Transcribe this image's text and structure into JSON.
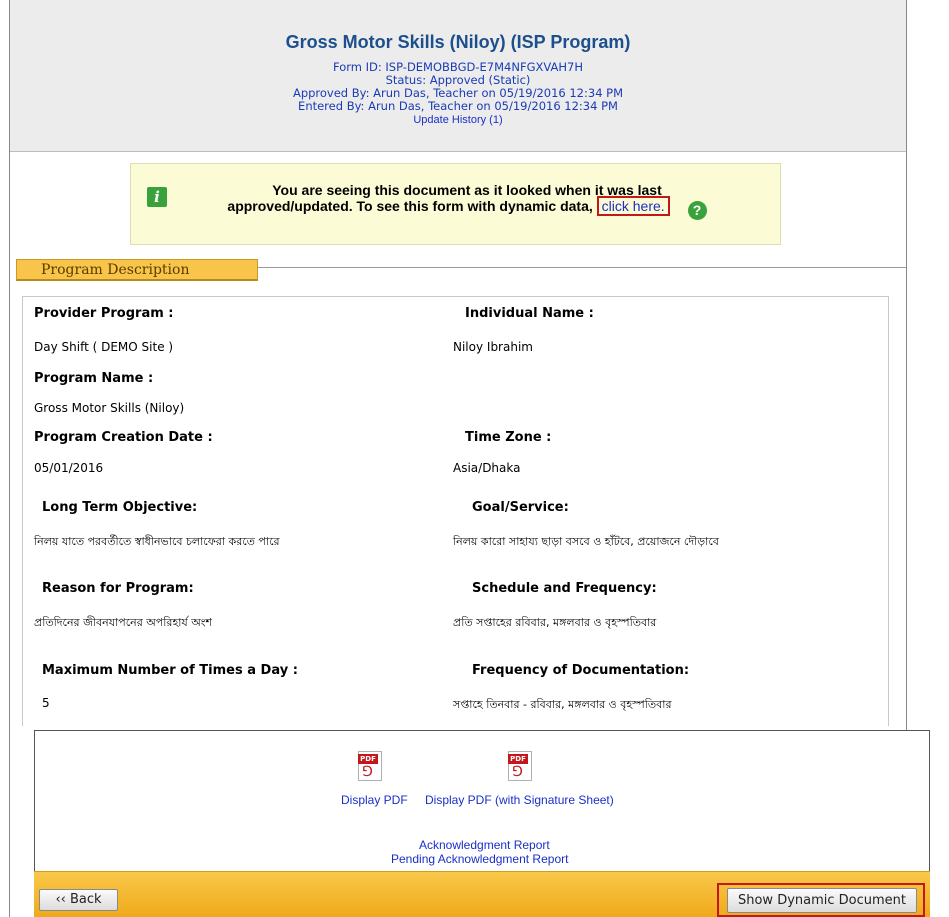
{
  "header": {
    "title": "Gross Motor Skills (Niloy) (ISP Program)",
    "form_id": "Form ID: ISP-DEMOBBGD-E7M4NFGXVAH7H",
    "status": "Status: Approved (Static)",
    "approved_by": "Approved By: Arun Das, Teacher on 05/19/2016 12:34 PM",
    "entered_by": "Entered By: Arun Das, Teacher on 05/19/2016 12:34 PM",
    "update_history": "Update History (1)"
  },
  "notice": {
    "text_line1": "You are seeing this document as it looked when it was last",
    "text_line2": "approved/updated. To see this form with dynamic data,",
    "link": "click here.",
    "info_icon": "i",
    "help_icon": "?"
  },
  "section": {
    "title": "Program Description"
  },
  "details": {
    "provider_program_label": "Provider Program :",
    "provider_program_value": "Day Shift ( DEMO Site )",
    "individual_name_label": "Individual Name :",
    "individual_name_value": "Niloy Ibrahim",
    "program_name_label": "Program Name :",
    "program_name_value": "Gross Motor Skills (Niloy)",
    "creation_date_label": "Program Creation Date :",
    "creation_date_value": "05/01/2016",
    "time_zone_label": "Time Zone :",
    "time_zone_value": "Asia/Dhaka",
    "long_term_label": "Long Term Objective:",
    "long_term_value": "নিলয় যাতে পরবর্তীতে স্বাধীনভাবে চলাফেরা করতে পারে",
    "goal_label": "Goal/Service:",
    "goal_value": "নিলয় কারো সাহায্য ছাড়া বসবে ও হাঁটবে, প্রয়োজনে দৌড়াবে",
    "reason_label": "Reason for Program:",
    "reason_value": "প্রতিদিনের জীবনযাপনের অপরিহার্য অংশ",
    "schedule_label": "Schedule and Frequency:",
    "schedule_value": "প্রতি সপ্তাহের রবিবার, মঙ্গলবার ও বৃহস্পতিবার",
    "max_times_label": "Maximum Number of Times a Day :",
    "max_times_value": "5",
    "freq_doc_label": "Frequency of Documentation:",
    "freq_doc_value": "সপ্তাহে তিনবার - রবিবার, মঙ্গলবার ও বৃহস্পতিবার"
  },
  "footer": {
    "pdf_tag": "PDF",
    "pdf_brand": "Adobe",
    "display_pdf": "Display PDF",
    "display_pdf_sig": "Display PDF (with Signature Sheet)",
    "ack_report": "Acknowledgment Report",
    "pending_ack_report": "Pending Acknowledgment Report",
    "back": "‹‹ Back",
    "show_dynamic": "Show Dynamic Document"
  }
}
